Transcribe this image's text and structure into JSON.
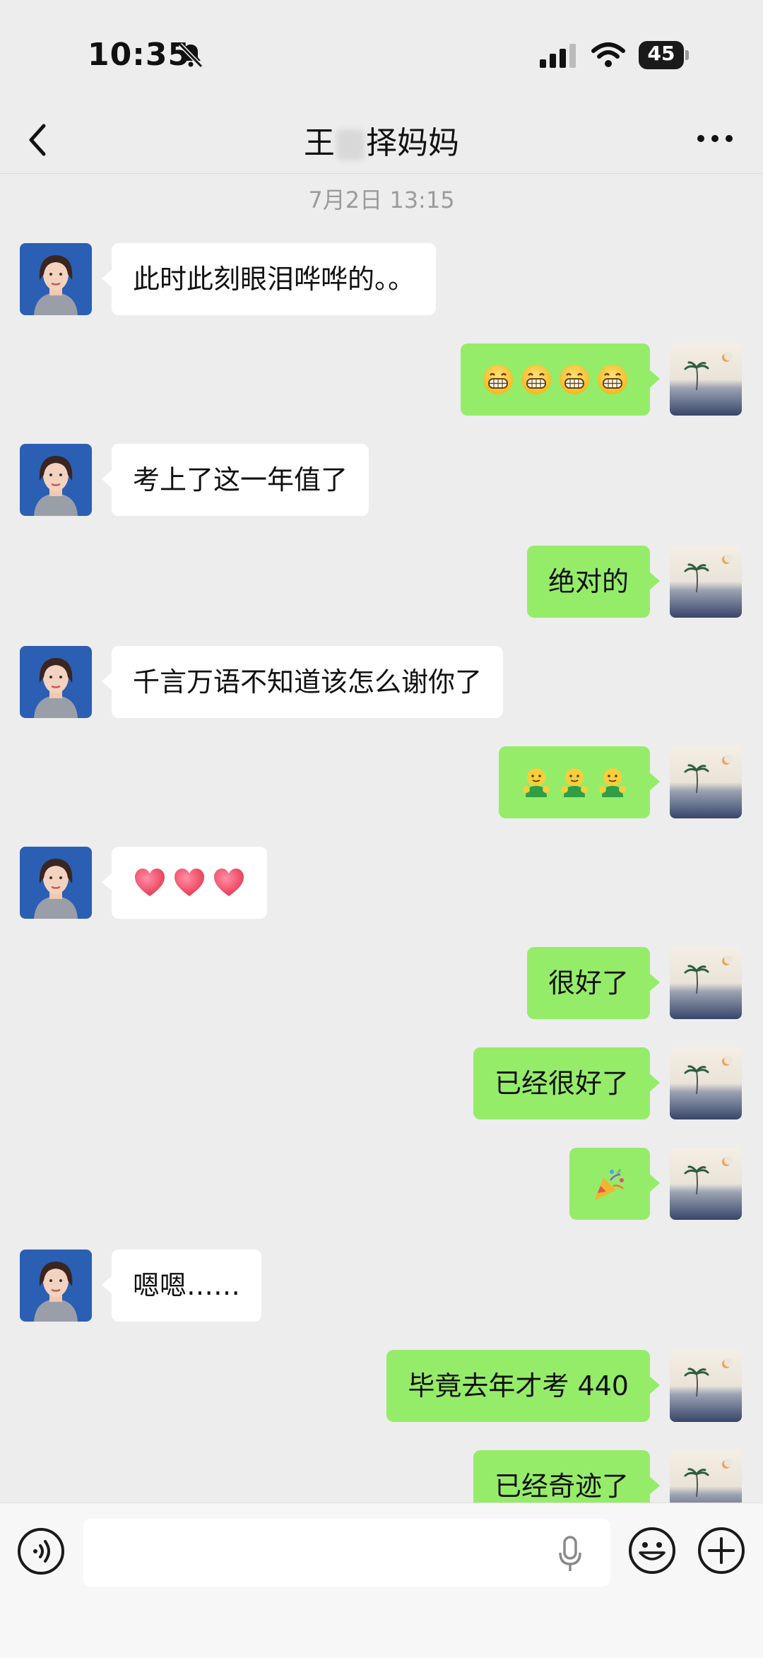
{
  "status_bar": {
    "time": "10:35",
    "battery_level": "45"
  },
  "nav": {
    "title_prefix": "王",
    "title_suffix": "择妈妈"
  },
  "timestamp": "7月2日 13:15",
  "messages": [
    {
      "side": "left",
      "text": "此时此刻眼泪哗哗的。。",
      "top": 0
    },
    {
      "side": "right",
      "emoji": [
        "grin-icon",
        "grin-icon",
        "grin-icon",
        "grin-icon"
      ]
    },
    {
      "side": "left",
      "text": "考上了这一年值了"
    },
    {
      "side": "right",
      "text": "绝对的"
    },
    {
      "side": "left",
      "text": "千言万语不知道该怎么谢你了"
    },
    {
      "side": "right",
      "emoji": [
        "hug-icon",
        "hug-icon",
        "hug-icon"
      ]
    },
    {
      "side": "left",
      "emoji": [
        "heart-icon",
        "heart-icon",
        "heart-icon"
      ]
    },
    {
      "side": "right",
      "text": "很好了"
    },
    {
      "side": "right",
      "text": "已经很好了"
    },
    {
      "side": "right",
      "emoji": [
        "party-popper-icon"
      ]
    },
    {
      "side": "left",
      "text": "嗯嗯……"
    },
    {
      "side": "right",
      "text": "毕竟去年才考 440"
    },
    {
      "side": "right",
      "text": "已经奇迹了"
    }
  ],
  "colors": {
    "bubble_right": "#95ec69",
    "bubble_left": "#ffffff",
    "background": "#ededed"
  },
  "input_bar": {
    "placeholder": ""
  }
}
